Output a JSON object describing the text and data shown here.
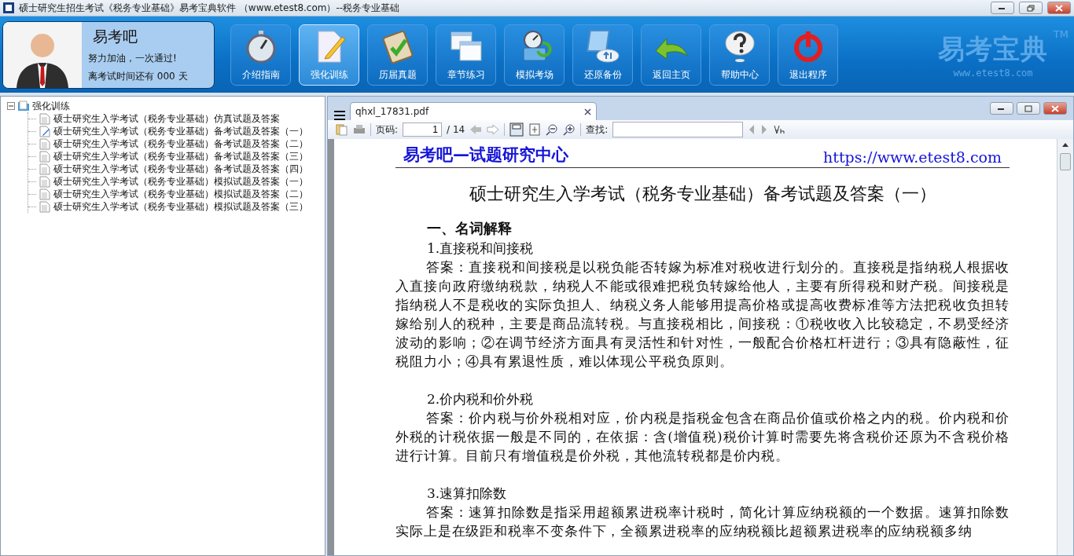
{
  "window": {
    "title": "硕士研究生招生考试《税务专业基础》易考宝典软件 （www.etest8.com）--税务专业基础"
  },
  "profile": {
    "name": "易考吧",
    "motto": "努力加油，一次通过!",
    "countdown": "离考试时间还有 000 天"
  },
  "toolbar": [
    {
      "label": "介绍指南",
      "kind": "stopwatch",
      "selected": false
    },
    {
      "label": "强化训练",
      "kind": "pencil",
      "selected": true
    },
    {
      "label": "历届真题",
      "kind": "clipboard",
      "selected": false
    },
    {
      "label": "章节练习",
      "kind": "windows",
      "selected": false
    },
    {
      "label": "模拟考场",
      "kind": "monitor",
      "selected": false
    },
    {
      "label": "还原备份",
      "kind": "cloud",
      "selected": false
    },
    {
      "label": "返回主页",
      "kind": "back",
      "selected": false
    },
    {
      "label": "帮助中心",
      "kind": "help",
      "selected": false
    },
    {
      "label": "退出程序",
      "kind": "power",
      "selected": false
    }
  ],
  "brand": {
    "name": "易考宝典",
    "tm": "TM",
    "url": "www.etest8.com"
  },
  "tree": {
    "label": "强化训练",
    "expanded": true,
    "children": [
      {
        "label": "硕士研究生入学考试（税务专业基础）仿真试题及答案",
        "kind": "doc"
      },
      {
        "label": "硕士研究生入学考试（税务专业基础）备考试题及答案（一）",
        "kind": "edit"
      },
      {
        "label": "硕士研究生入学考试（税务专业基础）备考试题及答案（二）",
        "kind": "doc"
      },
      {
        "label": "硕士研究生入学考试（税务专业基础）备考试题及答案（三）",
        "kind": "doc"
      },
      {
        "label": "硕士研究生入学考试（税务专业基础）备考试题及答案（四）",
        "kind": "doc"
      },
      {
        "label": "硕士研究生入学考试（税务专业基础）模拟试题及答案（一）",
        "kind": "doc"
      },
      {
        "label": "硕士研究生入学考试（税务专业基础）模拟试题及答案（二）",
        "kind": "doc"
      },
      {
        "label": "硕士研究生入学考试（税务专业基础）模拟试题及答案（三）",
        "kind": "doc"
      }
    ]
  },
  "viewer": {
    "tab": "qhxl_17831.pdf",
    "page_label": "页码:",
    "page": "1",
    "page_total": "/ 14",
    "find_label": "查找:"
  },
  "document": {
    "header_left": "易考吧—试题研究中心",
    "header_right": "https://www.etest8.com",
    "title": "硕士研究生入学考试（税务专业基础）备考试题及答案（一）",
    "section": "一、名词解释",
    "items": [
      {
        "heading": "1.直接税和间接税",
        "answer": "答案：直接税和间接税是以税负能否转嫁为标准对税收进行划分的。直接税是指纳税人根据收入直接向政府缴纳税款，纳税人不能或很难把税负转嫁给他人，主要有所得税和财产税。间接税是指纳税人不是税收的实际负担人、纳税义务人能够用提高价格或提高收费标准等方法把税收负担转嫁给别人的税种，主要是商品流转税。与直接税相比，间接税：①税收收入比较稳定，不易受经济波动的影响；②在调节经济方面具有灵活性和针对性，一般配合价格杠杆进行；③具有隐蔽性，征税阻力小；④具有累退性质，难以体现公平税负原则。"
      },
      {
        "heading": "2.价内税和价外税",
        "answer": "答案：价内税与价外税相对应，价内税是指税金包含在商品价值或价格之内的税。价内税和价外税的计税依据一般是不同的，在依据：含(增值税)税价计算时需要先将含税价还原为不含税价格进行计算。目前只有增值税是价外税，其他流转税都是价内税。"
      },
      {
        "heading": "3.速算扣除数",
        "answer": "答案：速算扣除数是指采用超额累进税率计税时，简化计算应纳税额的一个数据。速算扣除数实际上是在级距和税率不变条件下，全额累进税率的应纳税额比超额累进税率的应纳税额多纳"
      }
    ]
  }
}
